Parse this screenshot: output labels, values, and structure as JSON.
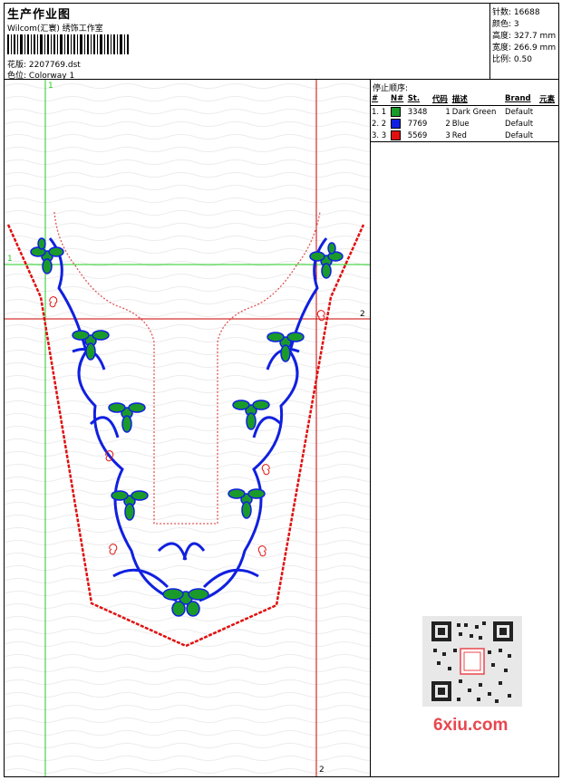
{
  "header": {
    "title": "生产作业图",
    "company": "Wilcom(汇寰) 绣饰工作室",
    "design_label": "花版:",
    "design_value": "2207769.dst",
    "colorway_label": "色位:",
    "colorway_value": "Colorway 1"
  },
  "stats": {
    "stitches_label": "针数:",
    "stitches_value": "16688",
    "colors_label": "颜色:",
    "colors_value": "3",
    "height_label": "高度:",
    "height_value": "327.7 mm",
    "width_label": "宽度:",
    "width_value": "266.9 mm",
    "scale_label": "比例:",
    "scale_value": "0.50"
  },
  "stop_sequence": {
    "heading": "停止顺序:",
    "columns": [
      "#",
      "N#",
      "St.",
      "代码",
      "描述",
      "Brand",
      "元素"
    ],
    "rows": [
      {
        "idx": "1. 1",
        "color": "#1a9a2a",
        "stitches": "3348",
        "code": "1",
        "desc": "Dark Green",
        "brand": "Default"
      },
      {
        "idx": "2. 2",
        "color": "#1020e0",
        "stitches": "7769",
        "code": "2",
        "desc": "Blue",
        "brand": "Default"
      },
      {
        "idx": "3. 3",
        "color": "#e01010",
        "stitches": "5569",
        "code": "3",
        "desc": "Red",
        "brand": "Default"
      }
    ]
  },
  "markers": {
    "v1_top": "1",
    "v2_bottom": "2",
    "h1_left": "1",
    "h2_right": "2"
  },
  "watermark": "6xiu.com",
  "colors": {
    "green": "#1a9a2a",
    "blue": "#1020e0",
    "red": "#e01010",
    "guide_green": "#22cc22",
    "guide_red": "#cc0000"
  }
}
